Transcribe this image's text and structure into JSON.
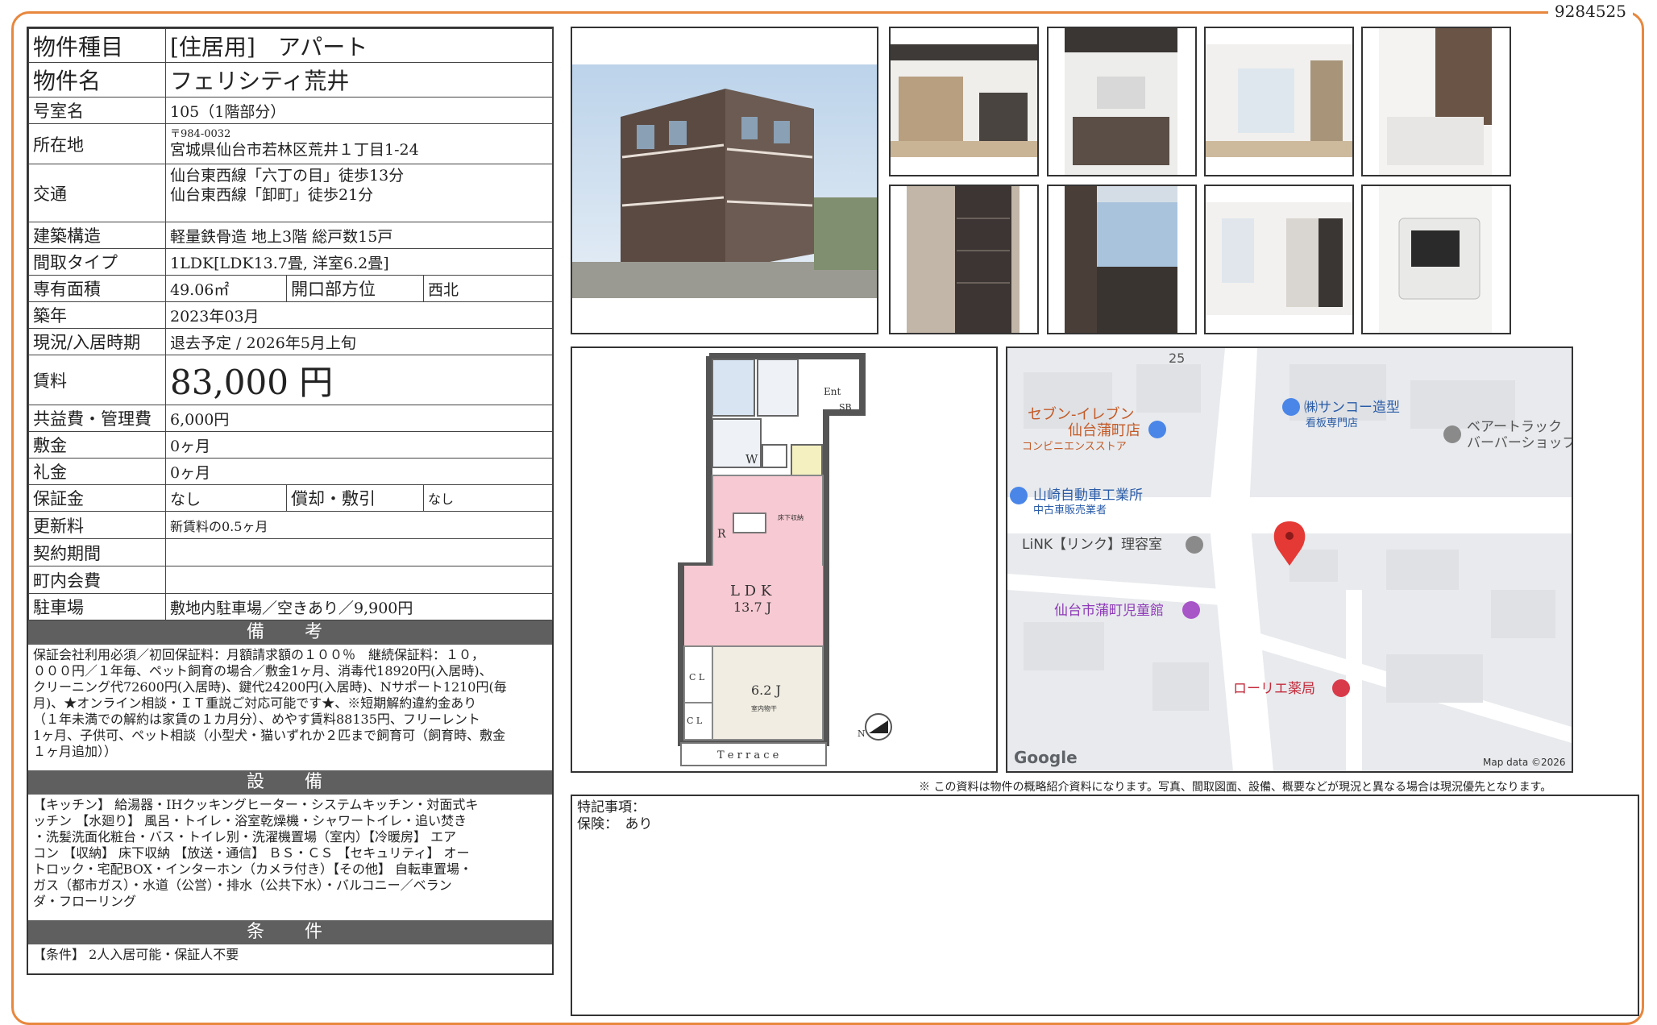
{
  "doc_id": "9284525",
  "property": {
    "type_label": "物件種目",
    "type_value": "[住居用]　アパート",
    "name_label": "物件名",
    "name_value": "フェリシティ荒井",
    "room_label": "号室名",
    "room_value": "105（1階部分）",
    "address_label": "所在地",
    "postal": "〒984-0032",
    "address": "宮城県仙台市若林区荒井１丁目1-24",
    "transport_label": "交通",
    "transport1": "仙台東西線「六丁の目」徒歩13分",
    "transport2": "仙台東西線「卸町」徒歩21分",
    "structure_label": "建築構造",
    "structure_value": "軽量鉄骨造 地上3階 総戸数15戸",
    "layout_label": "間取タイプ",
    "layout_value": "1LDK[LDK13.7畳, 洋室6.2畳]",
    "area_label": "専有面積",
    "area_value": "49.06㎡",
    "direction_label": "開口部方位",
    "direction_value": "西北",
    "built_label": "築年",
    "built_value": "2023年03月",
    "status_label": "現況/入居時期",
    "status_value": "退去予定 /  2026年5月上旬",
    "rent_label": "賃料",
    "rent_value": "83,000 円",
    "fee_label": "共益費・管理費",
    "fee_value": "6,000円",
    "deposit_label": "敷金",
    "deposit_value": "0ヶ月",
    "keymoney_label": "礼金",
    "keymoney_value": "0ヶ月",
    "guarantee_label": "保証金",
    "guarantee_value": "なし",
    "amort_label": "償却・敷引",
    "amort_value": "なし",
    "renewal_label": "更新料",
    "renewal_value": "新賃料の0.5ヶ月",
    "contract_label": "契約期間",
    "contract_value": "",
    "town_label": "町内会費",
    "town_value": "",
    "parking_label": "駐車場",
    "parking_value": "敷地内駐車場／空きあり／9,900円"
  },
  "remarks": {
    "title": "備　考",
    "lines": [
      "保証会社利用必須／初回保証料：月額請求額の１００％　継続保証料：１０，",
      "０００円／１年毎、ペット飼育の場合／敷金1ヶ月、消毒代18920円(入居時)、",
      "クリーニング代72600円(入居時)、鍵代24200円(入居時)、Nサポート1210円(毎",
      "月)、★オンライン相談・ＩＴ重説ご対応可能です★、※短期解約違約金あり",
      "（１年未満での解約は家賃の１カ月分）、めやす賃料88135円、フリーレント",
      "1ヶ月、子供可、ペット相談（小型犬・猫いずれか２匹まで飼育可（飼育時、敷金",
      "１ヶ月追加））"
    ]
  },
  "equipment": {
    "title": "設　備",
    "lines": [
      "【キッチン】 給湯器・IHクッキングヒーター・システムキッチン・対面式キ",
      "ッチン 【水廻り】 風呂・トイレ・浴室乾燥機・シャワートイレ・追い焚き",
      "・洗髪洗面化粧台・バス・トイレ別・洗濯機置場（室内）【冷暖房】 エア",
      "コン 【収納】 床下収納 【放送・通信】 ＢＳ・ＣＳ 【セキュリティ】 オー",
      "トロック・宅配BOX・インターホン（カメラ付き）【その他】 自転車置場・",
      "ガス（都市ガス）・水道（公営）・排水（公共下水）・バルコニー／ベラン",
      "ダ・フローリング"
    ]
  },
  "conditions": {
    "title": "条　件",
    "text": "【条件】 2人入居可能・保証人不要"
  },
  "floorplan": {
    "ent": "Ent",
    "sb": "SB",
    "w": "W",
    "r": "R",
    "storage": "床下収納",
    "ldk": "L D K",
    "ldk_size": "13.7 J",
    "room": "6.2 J",
    "room_sub": "室内物干",
    "cl1": "C L",
    "cl2": "C L",
    "terrace": "T e r r a c e",
    "north": "N"
  },
  "map": {
    "road": "25",
    "seven": "セブン-イレブン",
    "seven2": "仙台蒲町店",
    "seven_sub": "コンビニエンスストア",
    "sanko": "㈱サンコー造型",
    "sanko_sub": "看板専門店",
    "bear": "ベアートラック",
    "bear2": "バーバーショップ",
    "yamazaki": "山崎自動車工業所",
    "yamazaki_sub": "中古車販売業者",
    "link": "LiNK【リンク】理容室",
    "kids": "仙台市蒲町児童館",
    "pharmacy": "ローリエ薬局",
    "google": "Google",
    "mapdata": "Map data ©2026"
  },
  "notice": "※ この資料は物件の概略紹介資料になります。写真、間取図面、設備、概要などが現況と異なる場合は現況優先となります。",
  "notes": {
    "label": "特記事項：",
    "insurance": "保険：　あり"
  }
}
